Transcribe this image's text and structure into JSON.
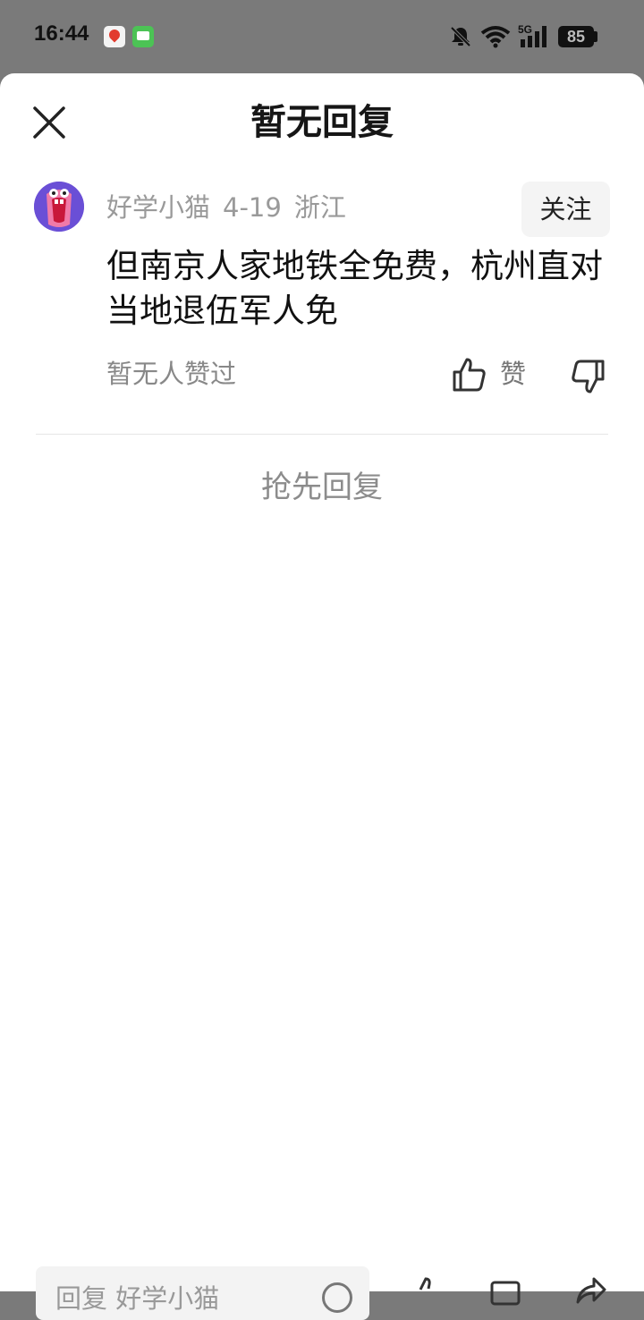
{
  "status_bar": {
    "time": "16:44",
    "battery": "85",
    "network": "5G"
  },
  "sheet": {
    "title": "暂无回复",
    "close_icon": "close-icon"
  },
  "comment": {
    "username": "好学小猫",
    "date": "4-19",
    "location": "浙江",
    "follow_label": "关注",
    "text": "但南京人家地铁全免费，杭州直对当地退伍军人免",
    "likes_status": "暂无人赞过",
    "like_label": "赞"
  },
  "replies": {
    "first_reply_label": "抢先回复"
  },
  "bottom_bar": {
    "input_placeholder": "回复 好学小猫"
  },
  "colors": {
    "overlay": "#7a7a7a",
    "sheet_bg": "#ffffff",
    "muted_text": "#9a9a9a",
    "avatar_bg": "#6a4fd6"
  }
}
